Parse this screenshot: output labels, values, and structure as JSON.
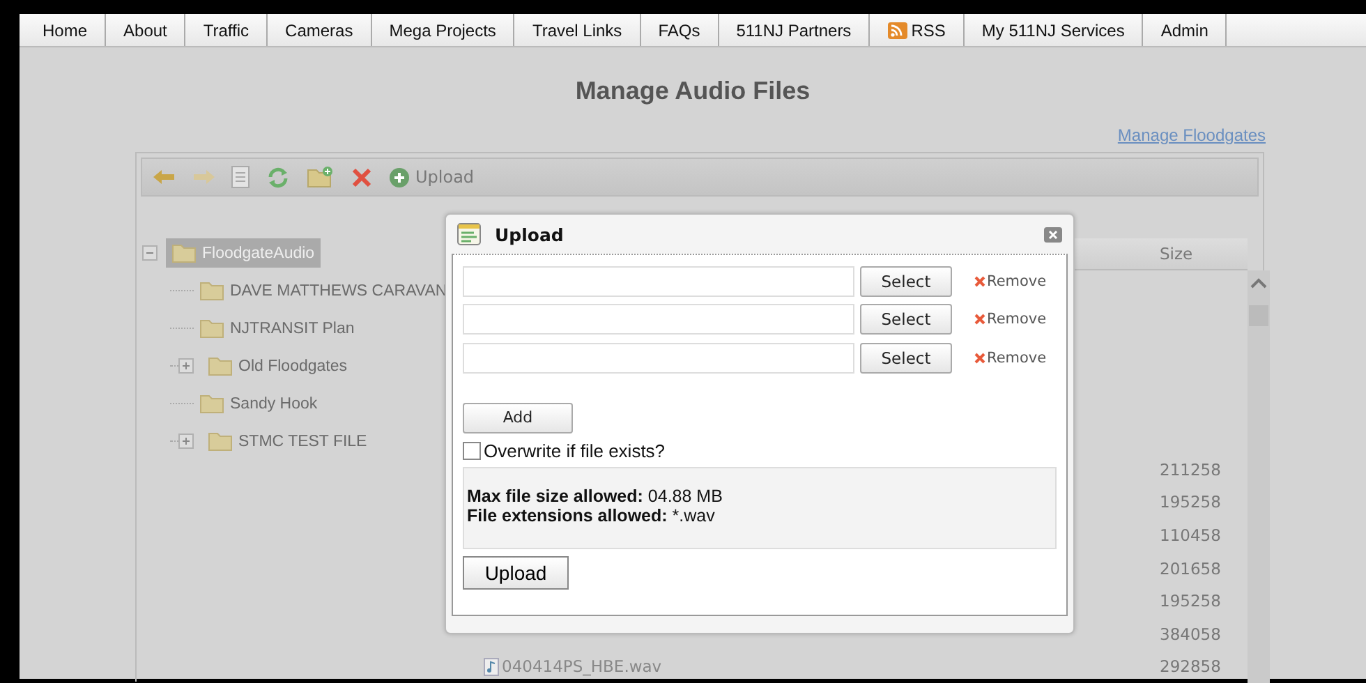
{
  "nav": [
    {
      "label": "Home",
      "kind": "link"
    },
    {
      "label": "About",
      "kind": "link"
    },
    {
      "label": "Traffic",
      "kind": "link"
    },
    {
      "label": "Cameras",
      "kind": "link"
    },
    {
      "label": "Mega Projects",
      "kind": "link"
    },
    {
      "label": "Travel Links",
      "kind": "link"
    },
    {
      "label": "FAQs",
      "kind": "link"
    },
    {
      "label": "511NJ Partners",
      "kind": "link"
    },
    {
      "label": "RSS",
      "kind": "feed"
    },
    {
      "label": "My 511NJ Services",
      "kind": "link"
    },
    {
      "label": "Admin",
      "kind": "link"
    }
  ],
  "page_title": "Manage Audio Files",
  "manage_link": "Manage Floodgates",
  "toolbar": {
    "upload_label": "Upload"
  },
  "tree": [
    {
      "label": "FloodgateAudio",
      "kind": "branch",
      "expanded": true,
      "selected": true,
      "children": [
        {
          "label": "DAVE MATTHEWS CARAVAN",
          "kind": "leaf",
          "selected": false
        },
        {
          "label": "NJTRANSIT Plan",
          "kind": "leaf",
          "selected": false
        },
        {
          "label": "Old Floodgates",
          "kind": "branch",
          "expanded": false,
          "selected": false
        },
        {
          "label": "Sandy Hook",
          "kind": "leaf",
          "selected": false
        },
        {
          "label": "STMC TEST FILE",
          "kind": "branch",
          "expanded": false,
          "selected": false
        }
      ]
    }
  ],
  "file_list": {
    "columns": [
      "Size"
    ],
    "rows": [
      {
        "size": "211258"
      },
      {
        "size": "195258"
      },
      {
        "size": "110458"
      },
      {
        "size": "201658"
      },
      {
        "size": "195258"
      },
      {
        "size": "384058"
      },
      {
        "name": "040414PS_HBE.wav",
        "size": "292858"
      }
    ]
  },
  "dialog": {
    "title": "Upload",
    "files": [
      {
        "select": "Select",
        "remove": "Remove"
      },
      {
        "select": "Select",
        "remove": "Remove"
      },
      {
        "select": "Select",
        "remove": "Remove"
      }
    ],
    "add": "Add",
    "overwrite": {
      "label": "Overwrite if file exists?",
      "checked": false
    },
    "info": [
      "**Max file size allowed:** 04.88 MB",
      "**File extensions allowed:** *.wav"
    ],
    "upload": "Upload"
  }
}
